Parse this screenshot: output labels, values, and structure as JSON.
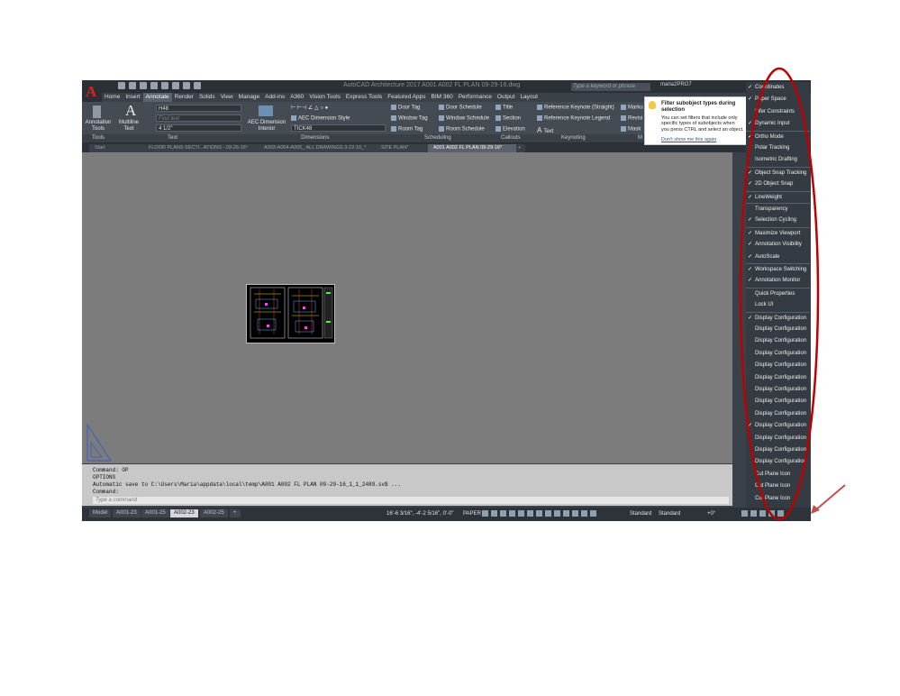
{
  "app": {
    "title": "AutoCAD Architecture 2017   A001 A002 FL PLAN 09-29-16.dwg",
    "search_placeholder": "Type a keyword or phrase",
    "user": "maria2PRO7",
    "logo_letter": "A"
  },
  "ribbon_tabs": [
    "Home",
    "Insert",
    "Annotate",
    "Render",
    "Solids",
    "View",
    "Manage",
    "Add-ins",
    "A360",
    "Vision Tools",
    "Express Tools",
    "Featured Apps",
    "BIM 360",
    "Performance",
    "Output",
    "Layout"
  ],
  "ribbon": {
    "annotation_tools": "Annotation Tools",
    "multiline_text": "Multiline Text",
    "text_style": "H48",
    "find_text_placeholder": "Find text",
    "text_height": "4 1/2\"",
    "aec_dimension": "AEC Dimension Interior",
    "aec_dimension_style": "AEC Dimension Style",
    "dim_style": "TICK48",
    "door_tag": "Door Tag",
    "window_tag": "Window Tag",
    "room_tag": "Room Tag",
    "door_schedule": "Door Schedule",
    "window_schedule": "Window Schedule",
    "room_schedule": "Room Schedule",
    "title": "Title",
    "section": "Section",
    "elevation": "Elevation",
    "ref_keynote_straight": "Reference Keynote (Straight)",
    "ref_keynote_legend": "Reference Keynote Legend",
    "text": "Text",
    "markup": "Marku",
    "revision": "Revisi",
    "mask": "Mask",
    "panels": [
      "Tools",
      "Text",
      "Dimensions",
      "Scheduling",
      "Callouts",
      "Keynoting",
      "M"
    ]
  },
  "doc_tabs": [
    "Start",
    "FLOOR PLANS SECTI...ATIONS - 09-26-16*",
    "A003-A004-A005_ ALL DRAWINGS 3-22-16_*",
    "SITE PLAN*",
    "A001 A002 FL PLAN 09-29-16*"
  ],
  "command": {
    "lines": [
      "Command: OP",
      "OPTIONS",
      "Automatic save to C:\\Users\\Maria\\appdata\\local\\temp\\A001 A002 FL PLAN 09-29-16_1_1_2489.sv$ ...",
      "Command:"
    ],
    "placeholder": "Type a command"
  },
  "layout_tabs": [
    "Model",
    "A001-23",
    "A001-25",
    "A002-23",
    "A002-25"
  ],
  "status": {
    "coords": "16'-6 3/16\", -4'-2 5/16\", 0'-0\"",
    "space": "PAPER",
    "dropdown1": "Standard",
    "dropdown2": "Standard",
    "offset": "+0°"
  },
  "tooltip": {
    "title": "Filter subobject types during selection",
    "body": "You can set filters that include only specific types of subobjects when you press CTRL and select an object.",
    "link": "Don't show me this again"
  },
  "customization_menu": [
    {
      "label": "Coordinates",
      "checked": true
    },
    {
      "label": "Paper Space",
      "checked": true
    },
    {
      "label": "Infer Constraints",
      "checked": false
    },
    {
      "label": "Dynamic Input",
      "checked": true
    },
    {
      "label": "Ortho Mode",
      "checked": true
    },
    {
      "label": "Polar Tracking",
      "checked": true
    },
    {
      "label": "Isometric Drafting",
      "checked": false
    },
    {
      "label": "Object Snap Tracking",
      "checked": true
    },
    {
      "label": "2D Object Snap",
      "checked": true
    },
    {
      "label": "LineWeight",
      "checked": true
    },
    {
      "label": "Transparency",
      "checked": false
    },
    {
      "label": "Selection Cycling",
      "checked": true
    },
    {
      "label": "Maximize Viewport",
      "checked": true
    },
    {
      "label": "Annotation Visibility",
      "checked": true
    },
    {
      "label": "AutoScale",
      "checked": true
    },
    {
      "label": "Workspace Switching",
      "checked": true
    },
    {
      "label": "Annotation Monitor",
      "checked": true
    },
    {
      "label": "Quick Properties",
      "checked": false
    },
    {
      "label": "Lock UI",
      "checked": false
    },
    {
      "label": "Display Configuration",
      "checked": true
    },
    {
      "label": "Display Configuration",
      "checked": false
    },
    {
      "label": "Display Configuration",
      "checked": false
    },
    {
      "label": "Display Configuration",
      "checked": false
    },
    {
      "label": "Display Configuration",
      "checked": false
    },
    {
      "label": "Display Configuration",
      "checked": false
    },
    {
      "label": "Display Configuration",
      "checked": false
    },
    {
      "label": "Display Configuration",
      "checked": false
    },
    {
      "label": "Display Configuration",
      "checked": false
    },
    {
      "label": "Display Configuration",
      "checked": true
    },
    {
      "label": "Display Configuration",
      "checked": false
    },
    {
      "label": "Display Configuration",
      "checked": false
    },
    {
      "label": "Display Configuration",
      "checked": false
    },
    {
      "label": "Cut Plane Icon",
      "checked": false
    },
    {
      "label": "Cut Plane Icon",
      "checked": false
    },
    {
      "label": "Cut Plane Icon",
      "checked": false
    }
  ],
  "annotation": {
    "ellipse_color": "#c00000",
    "arrow_color": "#c0504d"
  }
}
